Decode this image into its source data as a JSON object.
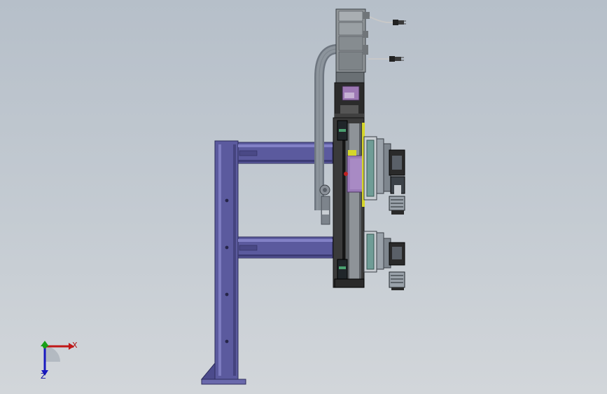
{
  "viewport": {
    "background_top": "#b6bfc9",
    "background_bottom": "#d2d6da"
  },
  "model": {
    "frame_color": "#5b5a9e",
    "frame_dark": "#3f3e78",
    "frame_light": "#7d7cc0",
    "carriage_color": "#9a7ab8",
    "motor_color": "#8f9497",
    "rail_color": "#2a2a2a",
    "accent_teal": "#6f9c96",
    "accent_yellow": "#d6d62a",
    "accent_red": "#c02020"
  },
  "triad": {
    "x_label": "X",
    "z_label": "Z",
    "x_color": "#c01818",
    "y_color": "#18a018",
    "z_color": "#1818c0"
  }
}
